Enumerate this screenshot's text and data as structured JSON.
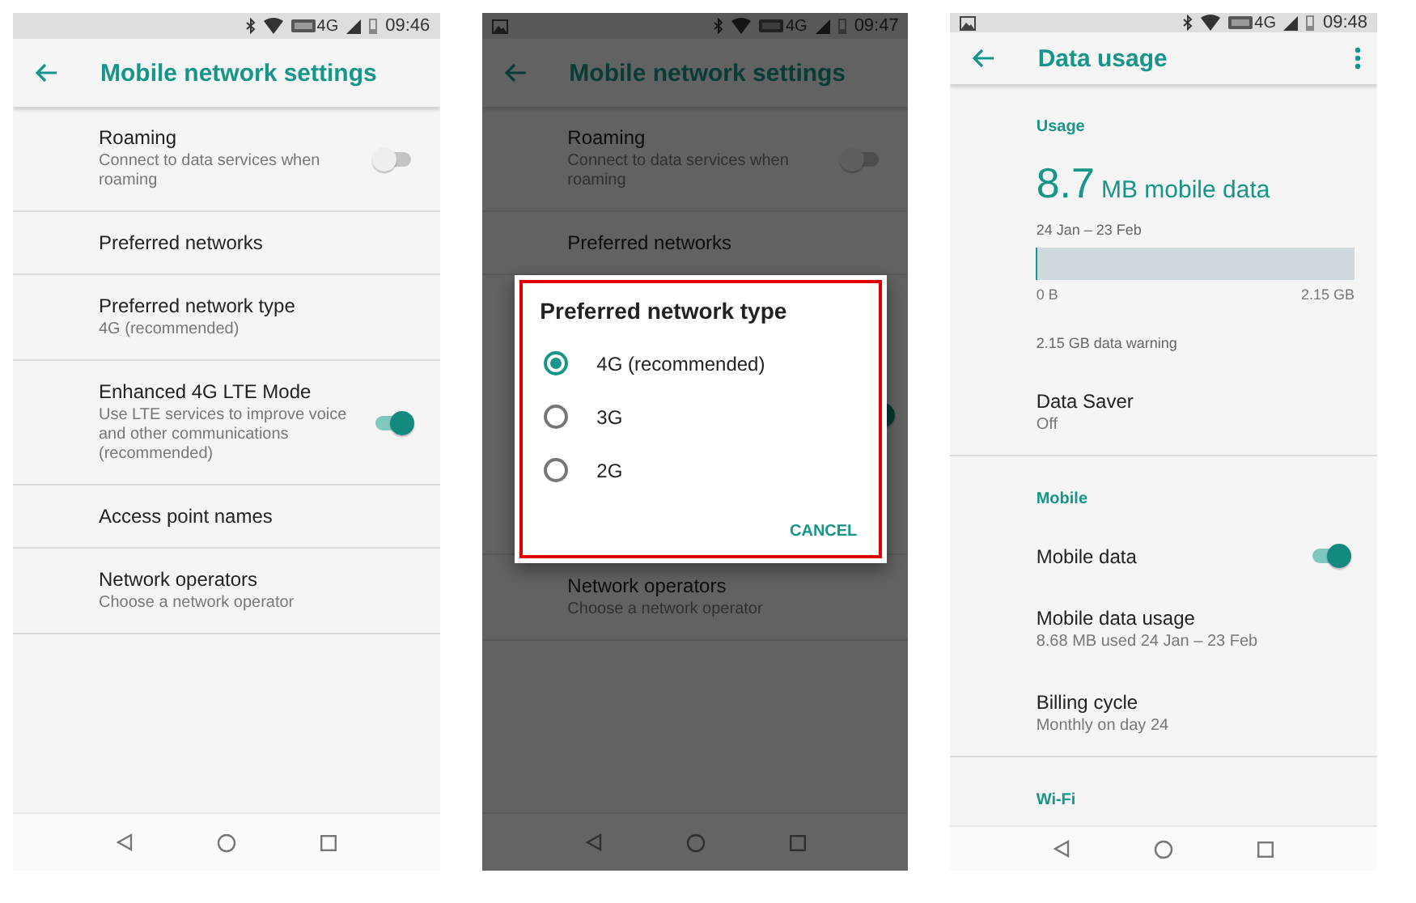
{
  "screens": [
    {
      "status_bar": {
        "notification_icon": false,
        "network": "4G",
        "time": "09:46"
      },
      "app_bar": {
        "title": "Mobile network settings",
        "overflow_menu": false
      },
      "dimmed": false,
      "items": [
        {
          "kind": "setting",
          "title": "Roaming",
          "summary": "Connect to data services when roaming",
          "toggle": false,
          "divider": true
        },
        {
          "kind": "setting",
          "title": "Preferred networks",
          "divider": true
        },
        {
          "kind": "setting",
          "title": "Preferred network type",
          "summary": "4G (recommended)",
          "divider": true
        },
        {
          "kind": "setting",
          "title": "Enhanced 4G LTE Mode",
          "summary": "Use LTE services to improve voice and other communications (recommended)",
          "toggle": true,
          "divider": true
        },
        {
          "kind": "setting",
          "title": "Access point names",
          "divider": true
        },
        {
          "kind": "setting",
          "title": "Network operators",
          "summary": "Choose a network operator",
          "divider": true
        }
      ]
    },
    {
      "status_bar": {
        "notification_icon": true,
        "network": "4G",
        "time": "09:47"
      },
      "app_bar": {
        "title": "Mobile network settings",
        "overflow_menu": false
      },
      "dimmed": true,
      "items": [
        {
          "kind": "setting",
          "title": "Roaming",
          "summary": "Connect to data services when roaming",
          "toggle": false,
          "divider": true
        },
        {
          "kind": "setting",
          "title": "Preferred networks",
          "divider": true
        },
        {
          "kind": "covered",
          "toggle": true,
          "divider": true
        },
        {
          "kind": "setting",
          "title": "Network operators",
          "summary": "Choose a network operator",
          "divider": true
        }
      ],
      "dialog": {
        "title": "Preferred network type",
        "highlight": true,
        "options": [
          {
            "label": "4G (recommended)",
            "selected": true
          },
          {
            "label": "3G",
            "selected": false
          },
          {
            "label": "2G",
            "selected": false
          }
        ],
        "button": "CANCEL"
      }
    },
    {
      "status_bar": {
        "notification_icon": true,
        "network": "4G",
        "time": "09:48"
      },
      "app_bar": {
        "title": "Data usage",
        "overflow_menu": true
      },
      "dimmed": false,
      "items": [
        {
          "kind": "header",
          "title": "Usage"
        },
        {
          "kind": "usage",
          "amount": "8.7",
          "unit": "MB mobile data",
          "period": "24 Jan – 23 Feb",
          "level": 0.004,
          "min": "0 B",
          "max": "2.15 GB",
          "warning": "2.15 GB data warning"
        },
        {
          "kind": "setting",
          "title": "Data Saver",
          "summary": "Off",
          "divider": true
        },
        {
          "kind": "header",
          "title": "Mobile"
        },
        {
          "kind": "setting",
          "title": "Mobile data",
          "toggle": true
        },
        {
          "kind": "setting",
          "title": "Mobile data usage",
          "summary": "8.68 MB used 24 Jan – 23 Feb"
        },
        {
          "kind": "setting",
          "title": "Billing cycle",
          "summary": "Monthly on day 24",
          "divider": true
        },
        {
          "kind": "header",
          "title": "Wi-Fi"
        }
      ]
    }
  ]
}
